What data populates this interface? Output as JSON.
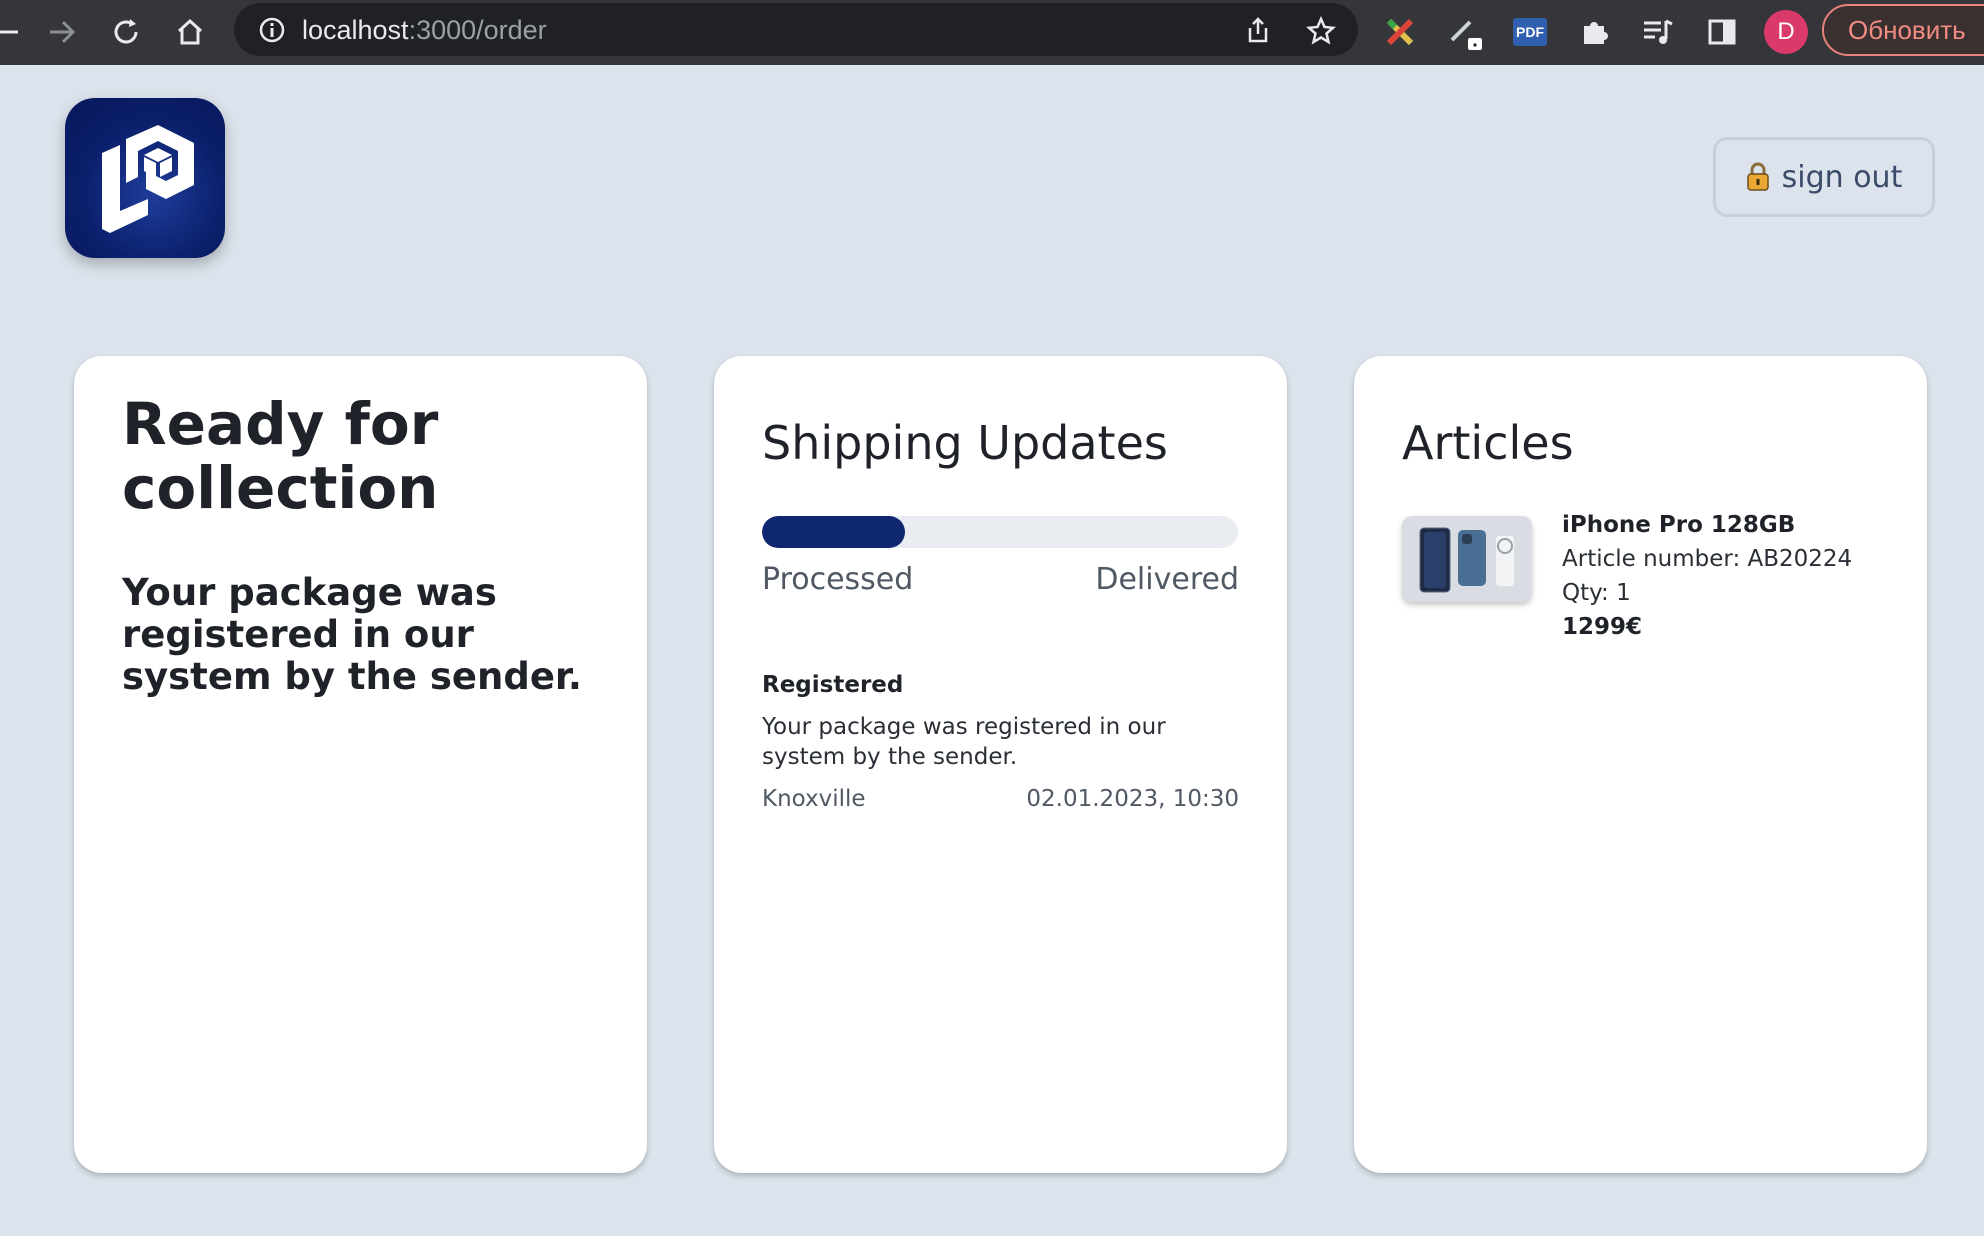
{
  "browser": {
    "url_host": "localhost",
    "url_path": ":3000/order",
    "profile_initial": "D",
    "update_label": "Обновить",
    "pdf_label": "PDF"
  },
  "header": {
    "sign_out_label": "sign out"
  },
  "status_card": {
    "title": "Ready for collection",
    "description": "Your package was registered in our system by the sender."
  },
  "shipping": {
    "title": "Shipping Updates",
    "progress": 0.3,
    "start_label": "Processed",
    "end_label": "Delivered",
    "events": [
      {
        "status": "Registered",
        "description": "Your package was registered in our system by the sender.",
        "location": "Knoxville",
        "time": "02.01.2023, 10:30"
      }
    ]
  },
  "articles": {
    "title": "Articles",
    "items": [
      {
        "name": "iPhone Pro 128GB",
        "article_number": "Article number: AB20224",
        "qty": "Qty: 1",
        "price": "1299€"
      }
    ]
  },
  "colors": {
    "accent": "#0f2670",
    "page_bg": "#dce3ec",
    "chrome_bg": "#35363a"
  }
}
